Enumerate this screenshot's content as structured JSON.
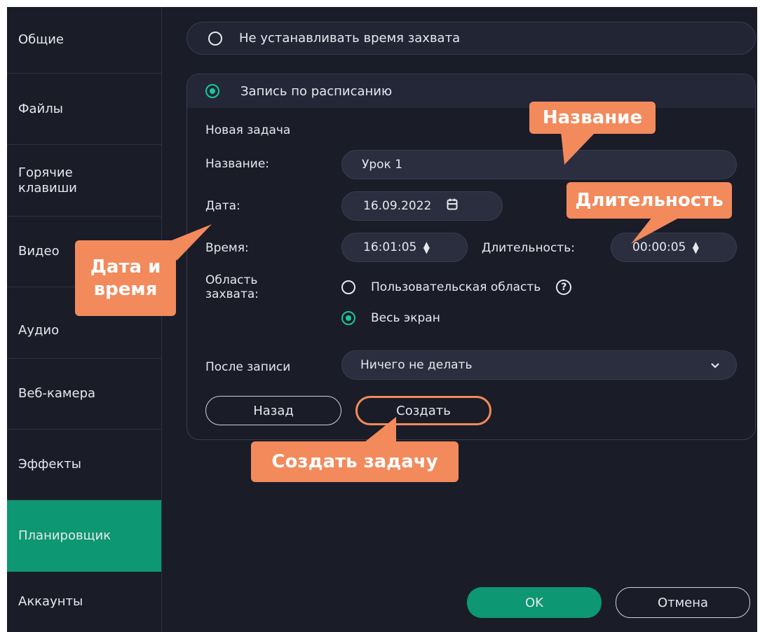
{
  "sidebar": {
    "items": [
      {
        "label": "Общие"
      },
      {
        "label": "Файлы"
      },
      {
        "label": "Горячие\nклавиши"
      },
      {
        "label": "Видео"
      },
      {
        "label": "Аудио"
      },
      {
        "label": "Веб-камера"
      },
      {
        "label": "Эффекты"
      },
      {
        "label": "Планировщик",
        "active": true
      },
      {
        "label": "Аккаунты"
      }
    ]
  },
  "capture": {
    "no_time_label": "Не устанавливать время захвата",
    "schedule_label": "Запись по расписанию"
  },
  "task": {
    "heading": "Новая задача",
    "name_label": "Название:",
    "name_value": "Урок 1",
    "date_label": "Дата:",
    "date_value": "16.09.2022",
    "time_label": "Время:",
    "time_value": "16:01:05",
    "duration_label": "Длительность:",
    "duration_value": "00:00:05",
    "area_label": "Область\nзахвата:",
    "area_options": [
      {
        "label": "Пользовательская область",
        "selected": false
      },
      {
        "label": "Весь экран",
        "selected": true
      }
    ],
    "after_label": "После записи",
    "after_value": "Ничего не делать",
    "back_button": "Назад",
    "create_button": "Создать"
  },
  "footer": {
    "ok_button": "OK",
    "cancel_button": "Отмена"
  },
  "callouts": {
    "name": "Название",
    "duration": "Длительность",
    "datetime": "Дата и\nвремя",
    "create": "Создать задачу"
  },
  "colors": {
    "background": "#1a1c28",
    "accent": "#0d9772",
    "radio_on": "#19c79a",
    "callout": "#f28a5c"
  }
}
